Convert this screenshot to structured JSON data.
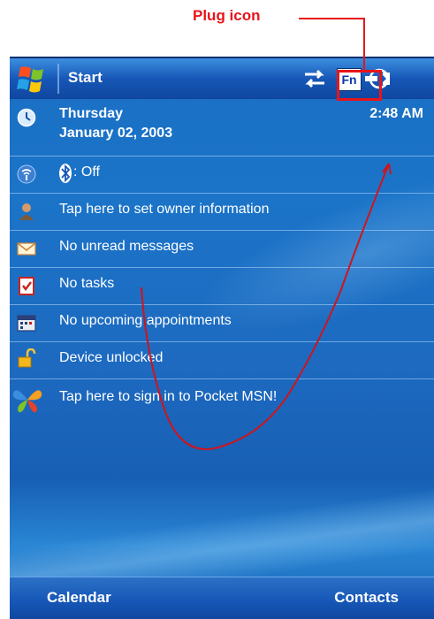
{
  "annotation": {
    "label": "Plug icon",
    "color": "#e8141a"
  },
  "titlebar": {
    "title": "Start",
    "fn_label": "Fn"
  },
  "today": {
    "day": "Thursday",
    "date": "January 02, 2003",
    "time": "2:48 AM",
    "items": [
      {
        "label": ": Off",
        "icon": "wireless-icon"
      },
      {
        "label": "Tap here to set owner information",
        "icon": "owner-icon"
      },
      {
        "label": "No unread messages",
        "icon": "envelope-icon"
      },
      {
        "label": "No tasks",
        "icon": "tasks-icon"
      },
      {
        "label": "No upcoming appointments",
        "icon": "calendar-icon"
      },
      {
        "label": "Device unlocked",
        "icon": "padlock-icon"
      },
      {
        "label": "Tap here to sign in to Pocket MSN!",
        "icon": "msn-butterfly-icon"
      }
    ]
  },
  "softkeys": {
    "left": "Calendar",
    "right": "Contacts"
  },
  "colors": {
    "accent": "#1757b7",
    "text": "#ffffff"
  }
}
